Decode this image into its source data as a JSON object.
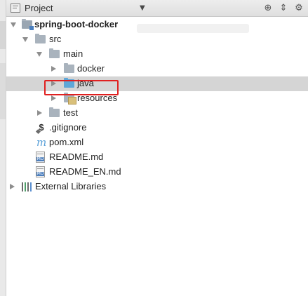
{
  "header": {
    "title": "Project",
    "dropdown_icon": "chevron-down-icon",
    "buttons": [
      "settings-target-icon",
      "split-icon",
      "gear-icon"
    ]
  },
  "tree": {
    "root_label": "spring-boot-docker",
    "src_label": "src",
    "main_label": "main",
    "docker_label": "docker",
    "java_label": "java",
    "resources_label": "resources",
    "test_label": "test",
    "gitignore_label": ".gitignore",
    "pom_label": "pom.xml",
    "readme_label": "README.md",
    "readme_en_label": "README_EN.md",
    "external_libraries_label": "External Libraries"
  },
  "colors": {
    "highlight": "#e02020",
    "selected_row": "#d5d5d5",
    "java_folder": "#5ea7d8"
  }
}
